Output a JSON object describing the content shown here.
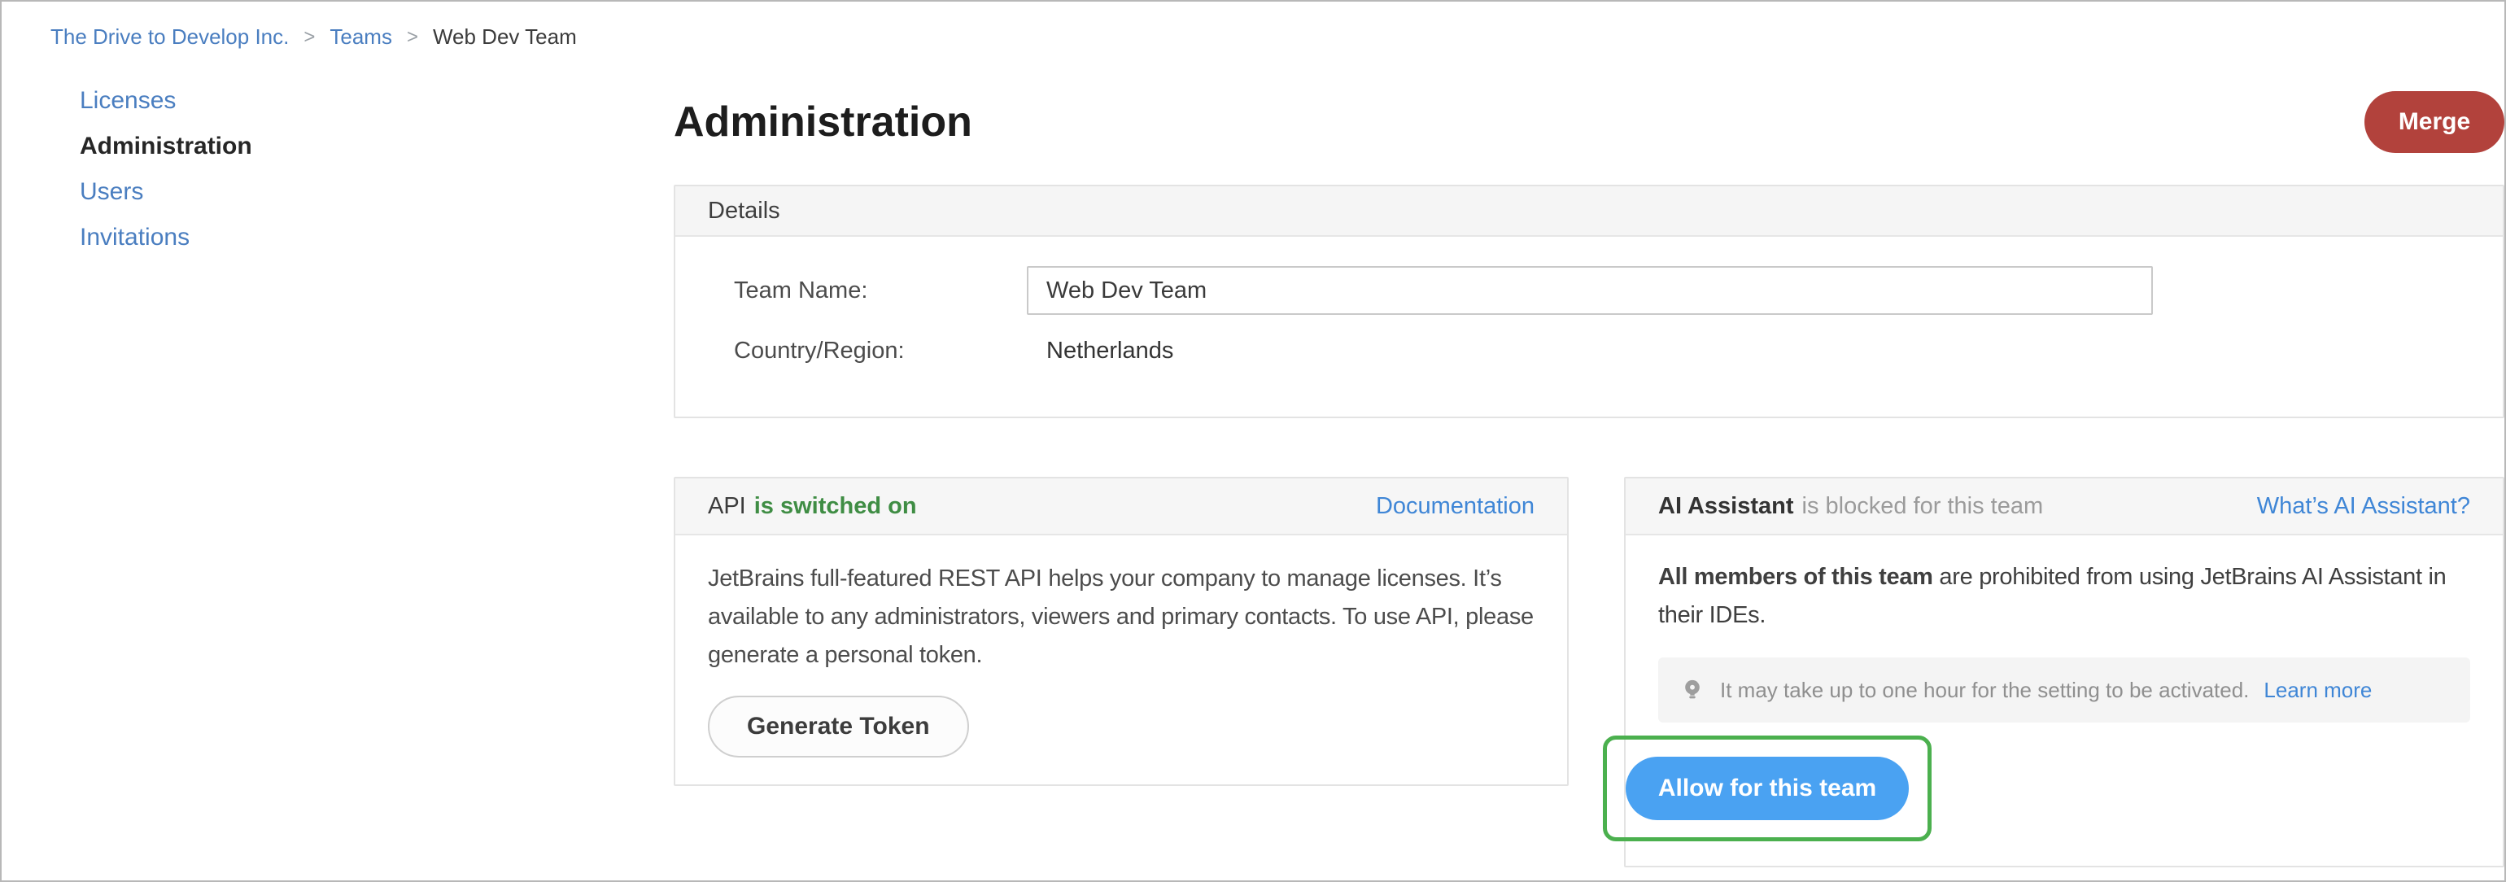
{
  "breadcrumb": {
    "items": [
      "The Drive to Develop Inc.",
      "Teams",
      "Web Dev Team"
    ],
    "separator": ">"
  },
  "sidebar": {
    "items": [
      "Licenses",
      "Administration",
      "Users",
      "Invitations"
    ],
    "active_item": "Administration"
  },
  "header": {
    "title": "Administration",
    "merge_label": "Merge"
  },
  "details": {
    "panel_title": "Details",
    "team_name_label": "Team Name:",
    "team_name_value": "Web Dev Team",
    "country_label": "Country/Region:",
    "country_value": "Netherlands"
  },
  "api_card": {
    "title": "API",
    "status": "is switched on",
    "doc_link": "Documentation",
    "body": "JetBrains full-featured REST API helps your company to manage licenses. It’s available to any administrators, viewers and primary contacts. To use API, please generate a personal token.",
    "button": "Generate Token"
  },
  "ai_card": {
    "title": "AI Assistant",
    "status": "is blocked for this team",
    "link": "What’s AI Assistant?",
    "body_bold": "All members of this team",
    "body_rest": " are prohibited from using JetBrains AI Assistant in their IDEs.",
    "note": "It may take up to one hour for the setting to be activated.",
    "note_link": "Learn more",
    "button": "Allow for this team",
    "icon": "lightbulb-icon"
  },
  "colors": {
    "nav_link_blue": "#4a7ec0",
    "card_link_blue": "#3f86d6",
    "success_green": "#3f8d44",
    "merge_red": "#b2423c",
    "allow_blue": "#4aa2f2",
    "highlight_green": "#4bb04e"
  }
}
